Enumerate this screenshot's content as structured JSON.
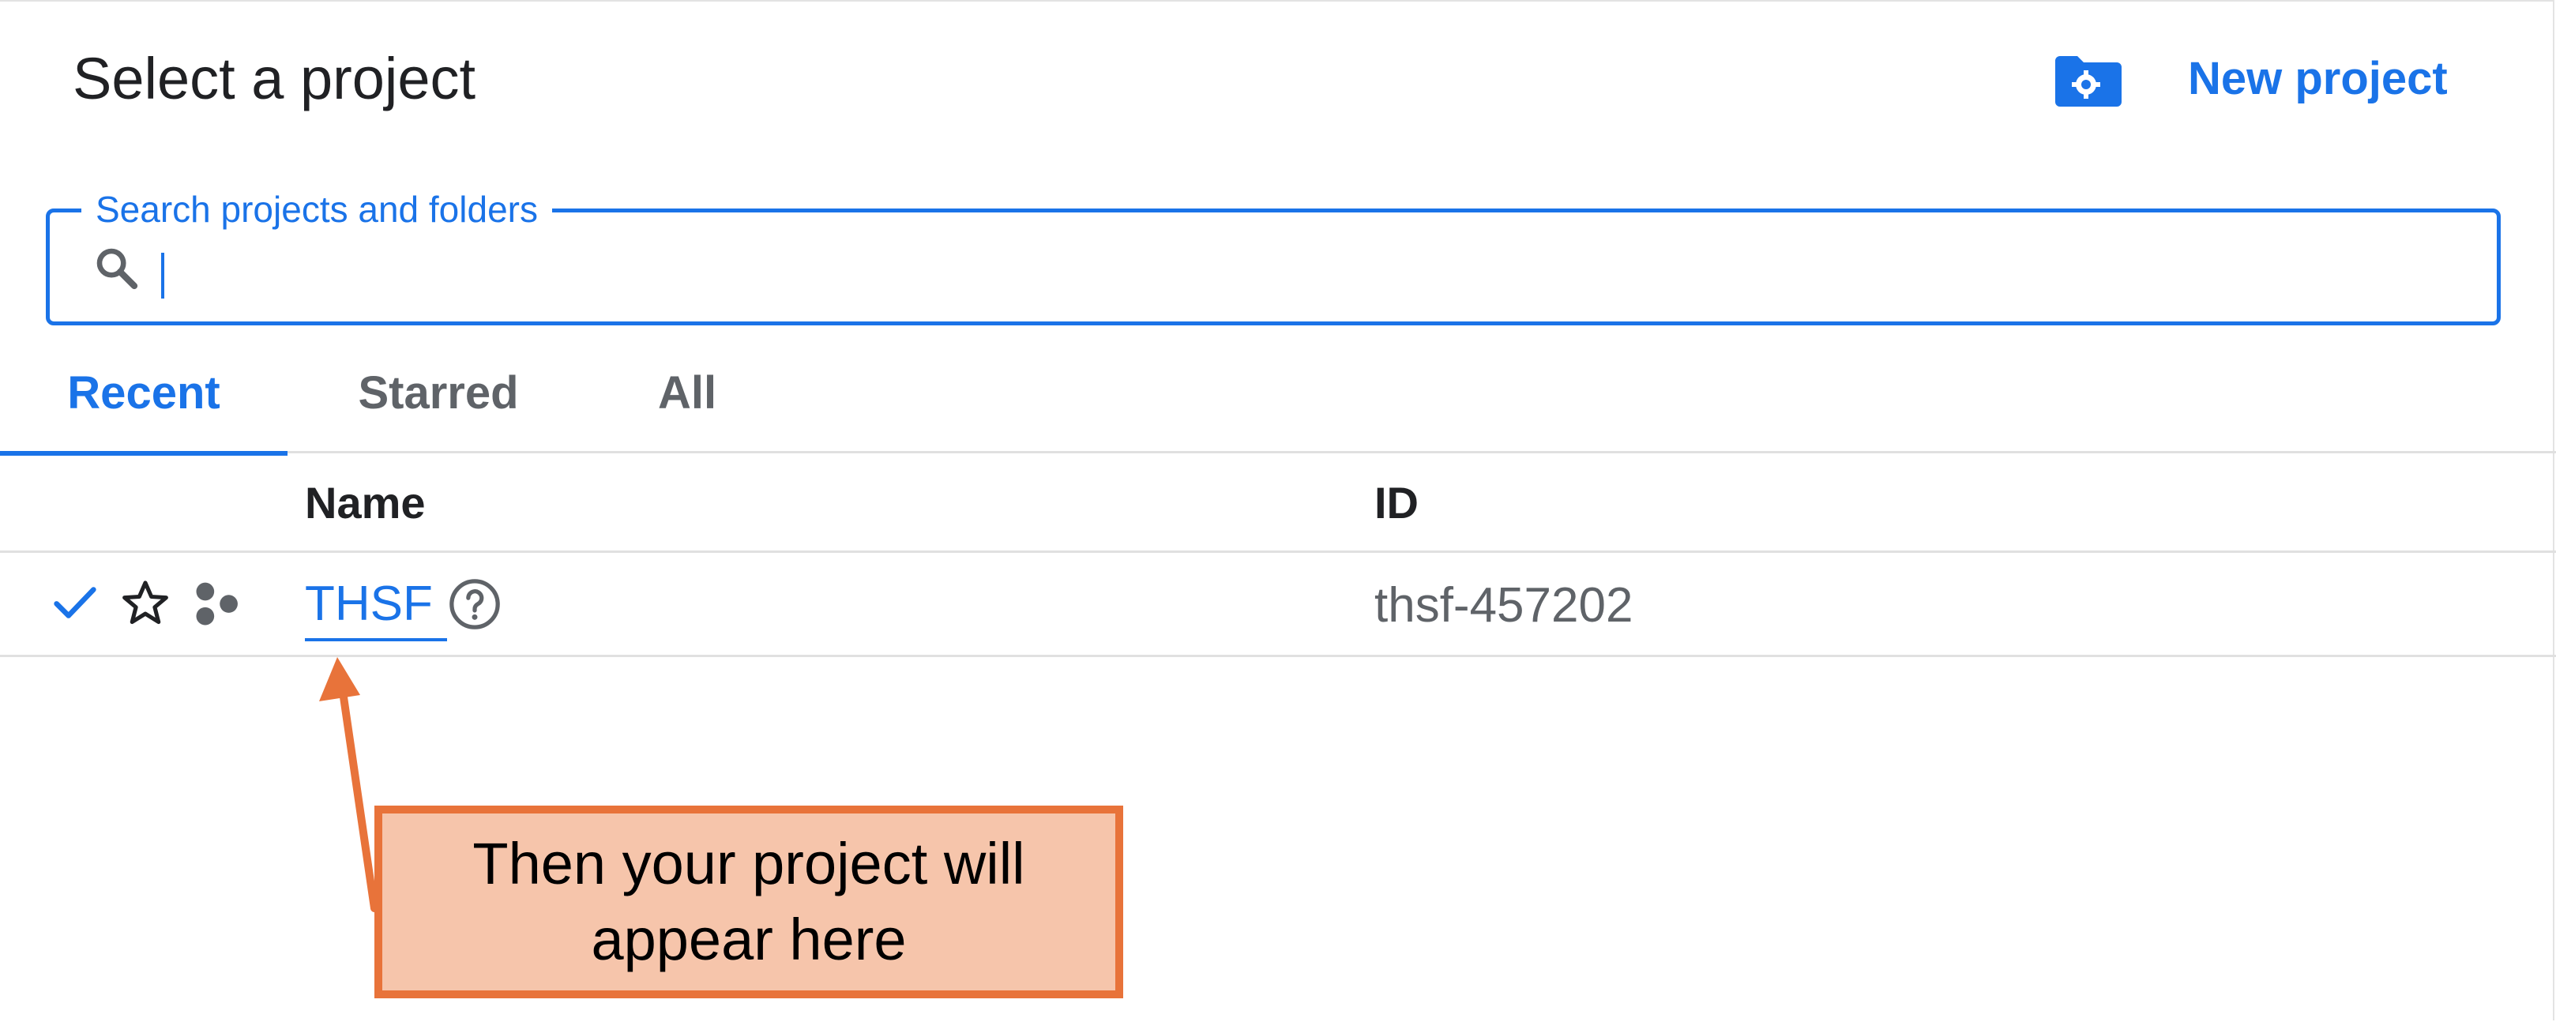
{
  "dialog": {
    "title": "Select a project",
    "new_project_label": "New project"
  },
  "search": {
    "label": "Search projects and folders",
    "value": "",
    "placeholder": ""
  },
  "tabs": [
    {
      "label": "Recent",
      "active": true
    },
    {
      "label": "Starred",
      "active": false
    },
    {
      "label": "All",
      "active": false
    }
  ],
  "table": {
    "columns": [
      "Name",
      "ID"
    ],
    "rows": [
      {
        "name": "THSF",
        "id": "thsf-457202",
        "selected": true,
        "starred": false
      }
    ]
  },
  "callout": {
    "text": "Then your project will appear here"
  },
  "colors": {
    "accent": "#1a73e8",
    "callout_fill": "#f6c5ab",
    "callout_border": "#e8733a"
  },
  "icons": [
    "new-project-folder-gear-icon",
    "search-icon",
    "check-icon",
    "star-outline-icon",
    "organization-icon",
    "help-icon"
  ]
}
